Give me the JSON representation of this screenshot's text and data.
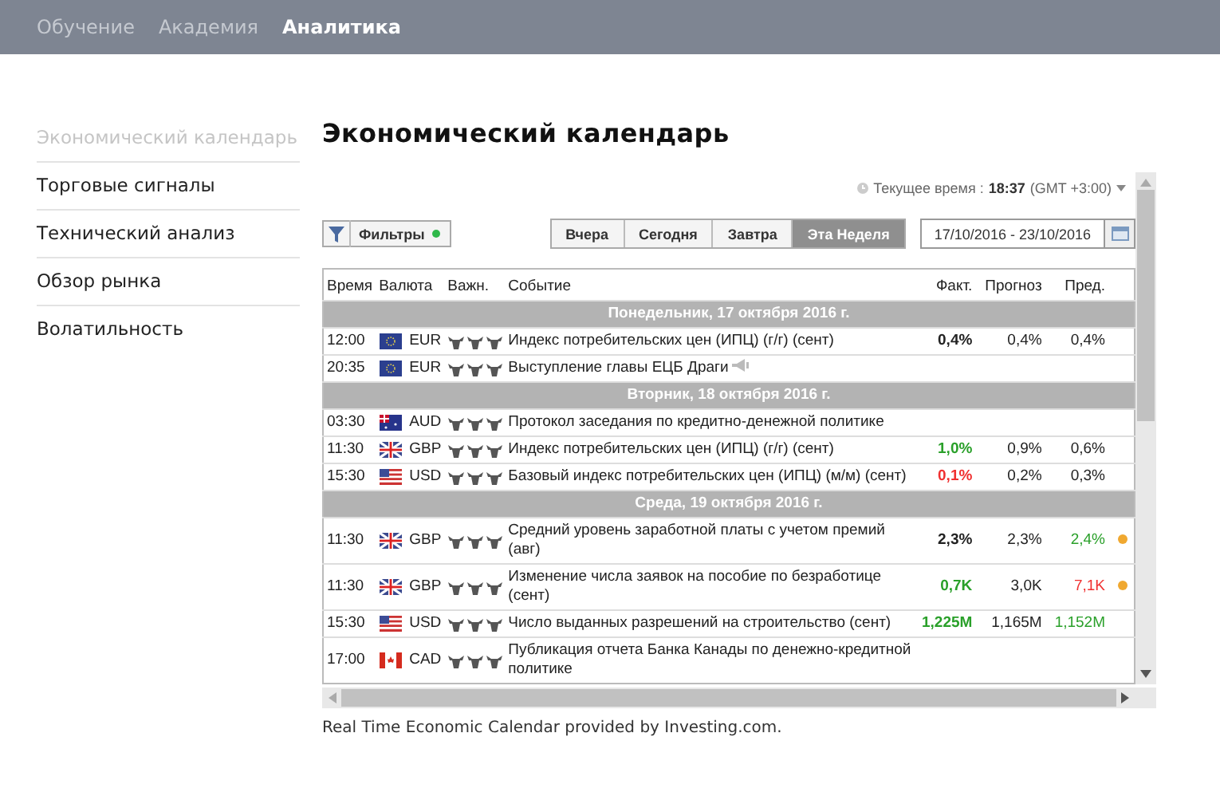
{
  "nav": [
    {
      "label": "Обучение",
      "selected": false
    },
    {
      "label": "Академия",
      "selected": false
    },
    {
      "label": "Аналитика",
      "selected": true
    }
  ],
  "sidebar": {
    "items": [
      {
        "label": "Экономический календарь",
        "selected": true
      },
      {
        "label": "Торговые сигналы",
        "selected": false
      },
      {
        "label": "Технический анализ",
        "selected": false
      },
      {
        "label": "Обзор рынка",
        "selected": false
      },
      {
        "label": "Волатильность",
        "selected": false
      }
    ]
  },
  "title": "Экономический календарь",
  "current_time": {
    "label": "Текущее время :",
    "time": "18:37",
    "zone": "(GMT +3:00)"
  },
  "filters": {
    "label": "Фильтры",
    "active": true
  },
  "range_tabs": [
    {
      "label": "Вчера",
      "selected": false
    },
    {
      "label": "Сегодня",
      "selected": false
    },
    {
      "label": "Завтра",
      "selected": false
    },
    {
      "label": "Эта Неделя",
      "selected": true
    }
  ],
  "date_range": "17/10/2016 - 23/10/2016",
  "table": {
    "columns": [
      "Время",
      "Валюта",
      "Важн.",
      "Событие",
      "Факт.",
      "Прогноз",
      "Пред."
    ],
    "rows": [
      {
        "kind": "day",
        "label": "Понедельник, 17 октября 2016 г."
      },
      {
        "kind": "event",
        "time": "12:00",
        "flag": {
          "kind": "eu"
        },
        "currency": "EUR",
        "stars": 3,
        "event": "Индекс потребительских цен (ИПЦ) (г/г) (сент)",
        "speech": false,
        "actual": {
          "text": "0,4%",
          "color": "#222222"
        },
        "forecast": "0,4%",
        "previous": {
          "text": "0,4%",
          "color": "#222222"
        },
        "revised": false
      },
      {
        "kind": "event",
        "time": "20:35",
        "flag": {
          "kind": "eu"
        },
        "currency": "EUR",
        "stars": 3,
        "event": "Выступление главы ЕЦБ Драги",
        "speech": true,
        "revised": false
      },
      {
        "kind": "day",
        "label": "Вторник, 18 октября 2016 г."
      },
      {
        "kind": "event",
        "time": "03:30",
        "flag": {
          "kind": "au"
        },
        "currency": "AUD",
        "stars": 3,
        "event": "Протокол заседания по кредитно-денежной политике",
        "speech": false,
        "revised": false
      },
      {
        "kind": "event",
        "time": "11:30",
        "flag": {
          "kind": "gb"
        },
        "currency": "GBP",
        "stars": 3,
        "event": "Индекс потребительских цен (ИПЦ) (г/г) (сент)",
        "speech": false,
        "actual": {
          "text": "1,0%",
          "color": "#2aa02a"
        },
        "forecast": "0,9%",
        "previous": {
          "text": "0,6%",
          "color": "#222222"
        },
        "revised": false
      },
      {
        "kind": "event",
        "time": "15:30",
        "flag": {
          "kind": "us"
        },
        "currency": "USD",
        "stars": 3,
        "event": "Базовый индекс потребительских цен (ИПЦ) (м/м) (сент)",
        "speech": false,
        "actual": {
          "text": "0,1%",
          "color": "#f03030"
        },
        "forecast": "0,2%",
        "previous": {
          "text": "0,3%",
          "color": "#222222"
        },
        "revised": false
      },
      {
        "kind": "day",
        "label": "Среда, 19 октября 2016 г."
      },
      {
        "kind": "event",
        "time": "11:30",
        "flag": {
          "kind": "gb"
        },
        "currency": "GBP",
        "stars": 3,
        "event": "Средний уровень заработной платы с учетом премий (авг)",
        "speech": false,
        "actual": {
          "text": "2,3%",
          "color": "#222222"
        },
        "forecast": "2,3%",
        "previous": {
          "text": "2,4%",
          "color": "#2aa02a"
        },
        "revised": true
      },
      {
        "kind": "event",
        "time": "11:30",
        "flag": {
          "kind": "gb"
        },
        "currency": "GBP",
        "stars": 3,
        "event": "Изменение числа заявок на пособие по безработице (сент)",
        "speech": false,
        "actual": {
          "text": "0,7K",
          "color": "#2aa02a"
        },
        "forecast": "3,0K",
        "previous": {
          "text": "7,1K",
          "color": "#f03030"
        },
        "revised": true
      },
      {
        "kind": "event",
        "time": "15:30",
        "flag": {
          "kind": "us"
        },
        "currency": "USD",
        "stars": 3,
        "event": "Число выданных разрешений на строительство (сент)",
        "speech": false,
        "actual": {
          "text": "1,225M",
          "color": "#2aa02a"
        },
        "forecast": "1,165M",
        "previous": {
          "text": "1,152M",
          "color": "#2aa02a"
        },
        "revised": false
      },
      {
        "kind": "event",
        "time": "17:00",
        "flag": {
          "kind": "ca"
        },
        "currency": "CAD",
        "stars": 3,
        "event": "Публикация отчета Банка Канады по денежно-кредитной политике",
        "speech": false,
        "revised": false
      }
    ]
  },
  "footer": {
    "text": "Real Time Economic Calendar provided by",
    "link": "Investing.com",
    "after": "."
  }
}
